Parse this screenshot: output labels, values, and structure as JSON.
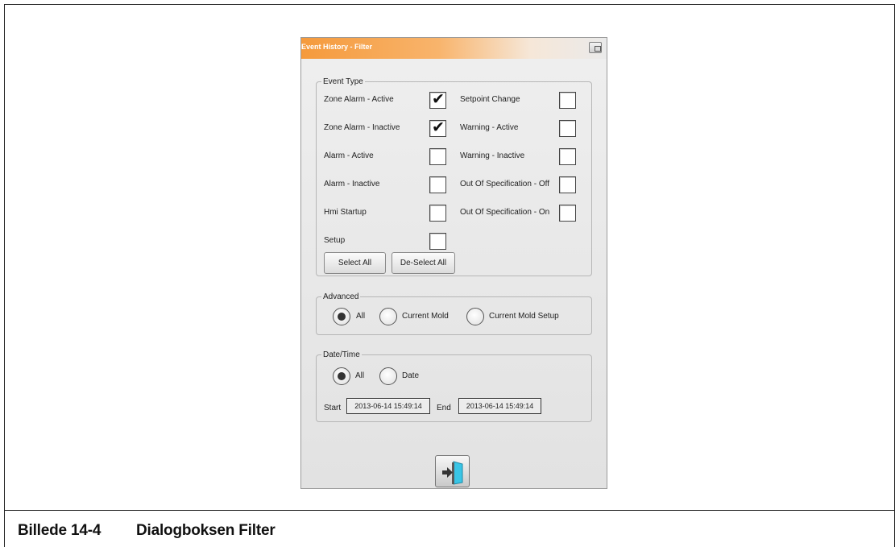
{
  "dialog": {
    "title": "Event History - Filter",
    "window_icon": "window-restore-icon"
  },
  "event_type": {
    "legend": "Event Type",
    "left_items": [
      {
        "label": "Zone Alarm - Active",
        "checked": true
      },
      {
        "label": "Zone Alarm - Inactive",
        "checked": true
      },
      {
        "label": "Alarm - Active",
        "checked": false
      },
      {
        "label": "Alarm - Inactive",
        "checked": false
      },
      {
        "label": "Hmi Startup",
        "checked": false
      },
      {
        "label": "Setup",
        "checked": false
      }
    ],
    "right_items": [
      {
        "label": "Setpoint Change",
        "checked": false
      },
      {
        "label": "Warning - Active",
        "checked": false
      },
      {
        "label": "Warning - Inactive",
        "checked": false
      },
      {
        "label": "Out Of Specification - Off",
        "checked": false
      },
      {
        "label": "Out Of Specification - On",
        "checked": false
      }
    ],
    "check_glyph": "✔",
    "select_all_label": "Select All",
    "deselect_all_label": "De-Select All"
  },
  "advanced": {
    "legend": "Advanced",
    "options": [
      {
        "label": "All",
        "selected": true
      },
      {
        "label": "Current Mold",
        "selected": false
      },
      {
        "label": "Current Mold Setup",
        "selected": false
      }
    ]
  },
  "date_time": {
    "legend": "Date/Time",
    "options": [
      {
        "label": "All",
        "selected": true
      },
      {
        "label": "Date",
        "selected": false
      }
    ],
    "start_label": "Start",
    "start_value": "2013-06-14 15:49:14",
    "end_label": "End",
    "end_value": "2013-06-14 15:49:14"
  },
  "exit_button_icon": "exit-door-icon",
  "caption": {
    "number": "Billede 14-4",
    "text": "Dialogboksen Filter"
  },
  "colors": {
    "titlebar_accent": "#f59a3c",
    "dialog_bg": "#e7e7e7",
    "door_color": "#39c5e6"
  }
}
